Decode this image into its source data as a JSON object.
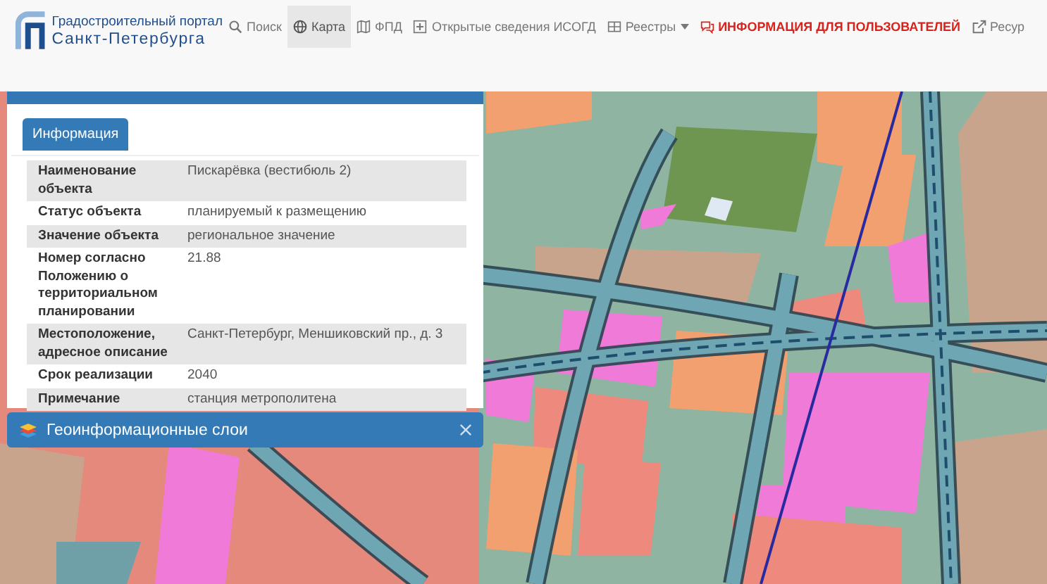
{
  "logo": {
    "line_1": "Градостроительный портал",
    "line_2": "Санкт-Петербурга"
  },
  "nav": [
    {
      "label": "Поиск",
      "selected": false,
      "kind": "plain",
      "has_menu": false
    },
    {
      "label": "Карта",
      "selected": true,
      "kind": "plain",
      "has_menu": false
    },
    {
      "label": "ФПД",
      "selected": false,
      "kind": "plain",
      "has_menu": false
    },
    {
      "label": "Открытые сведения ИСОГД",
      "selected": false,
      "kind": "plain",
      "has_menu": false
    },
    {
      "label": "Реестры",
      "selected": false,
      "kind": "plain",
      "has_menu": true
    },
    {
      "label": "ИНФОРМАЦИЯ ДЛЯ ПОЛЬЗОВАТЕЛЕЙ",
      "selected": false,
      "kind": "alert",
      "has_menu": false
    },
    {
      "label": "Ресур",
      "selected": false,
      "kind": "plain",
      "has_menu": false
    }
  ],
  "info_panel": {
    "tabs": [
      {
        "label": "Информация",
        "selected": true
      }
    ],
    "rows": [
      {
        "label": "Наименование объекта",
        "value": "Пискарёвка (вестибюль 2)"
      },
      {
        "label": "Статус объекта",
        "value": "планируемый к размещению"
      },
      {
        "label": "Значение объекта",
        "value": "региональное значение"
      },
      {
        "label": "Номер согласно Положению о территориальном планировании",
        "value": "21.88"
      },
      {
        "label": "Местоположение, адресное описание",
        "value": "Санкт-Петербург, Меншиковский пр., д. 3"
      },
      {
        "label": "Срок реализации",
        "value": "2040"
      },
      {
        "label": "Примечание",
        "value": "станция метрополитена"
      }
    ]
  },
  "layers_panel": {
    "title": "Геоинформационные слои"
  }
}
